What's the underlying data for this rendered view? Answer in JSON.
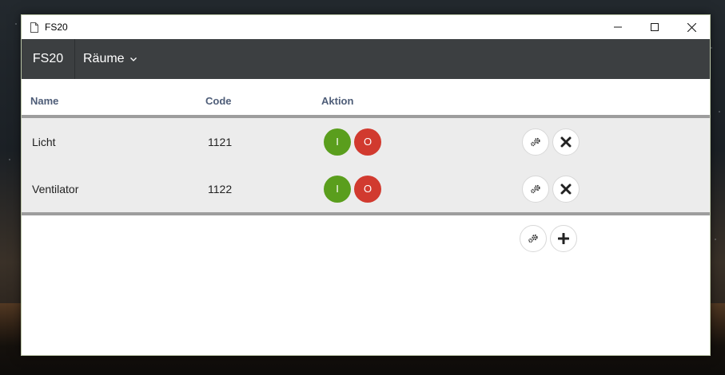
{
  "window": {
    "title": "FS20",
    "controls": {
      "minimize": "—",
      "maximize": "☐",
      "close": "✕"
    }
  },
  "navbar": {
    "brand": "FS20",
    "dropdown_label": "Räume"
  },
  "table": {
    "headers": {
      "name": "Name",
      "code": "Code",
      "action": "Aktion"
    },
    "rows": [
      {
        "name": "Licht",
        "code": "1121",
        "on_label": "I",
        "off_label": "O"
      },
      {
        "name": "Ventilator",
        "code": "1122",
        "on_label": "I",
        "off_label": "O"
      }
    ]
  },
  "colors": {
    "navbar": "#3c3f41",
    "on_button": "#5a9e1d",
    "off_button": "#d13a2f",
    "header_text": "#4e5d78",
    "row_background": "#ececec"
  },
  "icons": {
    "settings": "gears-icon",
    "delete": "times-icon",
    "add": "plus-icon"
  }
}
